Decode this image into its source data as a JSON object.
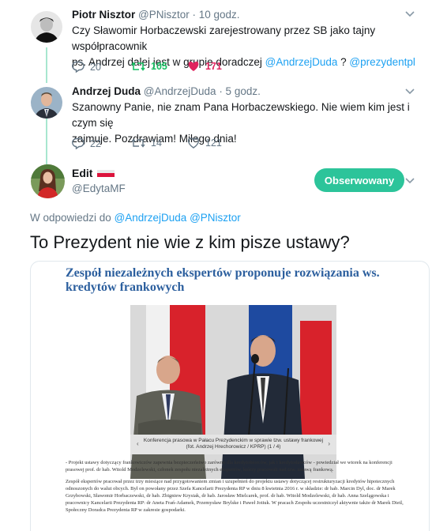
{
  "tweet1": {
    "name": "Piotr Nisztor",
    "handle": "@PNisztor",
    "time": "· 10 godz.",
    "line1": "Czy Sławomir Horbaczewski zarejestrowany przez SB jako tajny współpracownik",
    "line2_prefix": "ps. Andrzej dalej jest w grupie doradczej ",
    "mention1": "@AndrzejDuda",
    "sep": " ? ",
    "mention2": "@prezydentpl",
    "replies": "20",
    "retweets": "105",
    "likes": "171"
  },
  "tweet2": {
    "name": "Andrzej Duda",
    "handle": "@AndrzejDuda",
    "time": "· 5 godz.",
    "line1": "Szanowny Panie, nie znam Pana Horbaczewskiego. Nie wiem kim jest i czym się",
    "line2": "zajmuje. Pozdrawiam! Miłego dnia!",
    "replies": "22",
    "retweets": "14",
    "likes": "121"
  },
  "tweet3": {
    "name": "Edit",
    "handle": "@EdytaMF",
    "follow_label": "Obserwowany",
    "reply_prefix": "W odpowiedzi do ",
    "reply_mention1": "@AndrzejDuda",
    "reply_mention2": "@PNisztor",
    "text": "To Prezydent nie wie z kim pisze ustawy?"
  },
  "card": {
    "title": "Zespół niezależnych ekspertów proponuje rozwiązania ws. kredytów frankowych",
    "caption1": "Konferencja prasowa w Pałacu Prezydenckim w sprawie tzw. ustawy frankowej",
    "caption2": "(fot. Andrzej Hrechorowicz / KPRP) (1 / 4)",
    "nav_prev": "‹",
    "nav_next": "›",
    "para1": "- Projekt ustawy dotyczący frankowiczów zapewnia bezpieczeństwo zarówno dla kredytobiorców, jak i kredytodawców - powiedział we wtorek na konferencji prasowej prof. dr hab. Witold Modzelewski, członek zespołu niezależnych ekspertów, którzy pracowali nad tzw. ustawą frankową.",
    "para2": "Zespół ekspertów pracował przez trzy miesiące nad przygotowaniem zmian i uzupełnień do projektu ustawy dotyczącej restrukturyzacji kredytów hipotecznych odnoszonych do walut obcych. Był on powołany przez Szefa Kancelarii Prezydenta RP w dniu 8 kwietnia 2016 r. w składzie: dr hab. Marcin Dyl, doc. dr Marek Grzybowski, Sławomir Horbaczewski, dr hab. Zbigniew Krysiak, dr hab. Jarosław Mielcarek, prof. dr hab. Witold Modzelewski, dr hab. Anna Szelągowska i pracownicy Kancelarii Prezydenta RP: dr Aneta Frań-Adamek, Przemysław Brylske i Paweł Jotiuk. W pracach Zespołu uczestniczył aktywnie także dr Marek Dietl, Społeczny Doradca Prezydenta RP w zakresie gospodarki."
  },
  "colors": {
    "accent": "#1da1f2",
    "retweet": "#17bf63",
    "like": "#e0245e",
    "follow": "#2cc49a",
    "thread": "#a8e6cf"
  },
  "icons": [
    "reply-icon",
    "retweet-icon",
    "heart-icon",
    "chevron-down-icon"
  ]
}
